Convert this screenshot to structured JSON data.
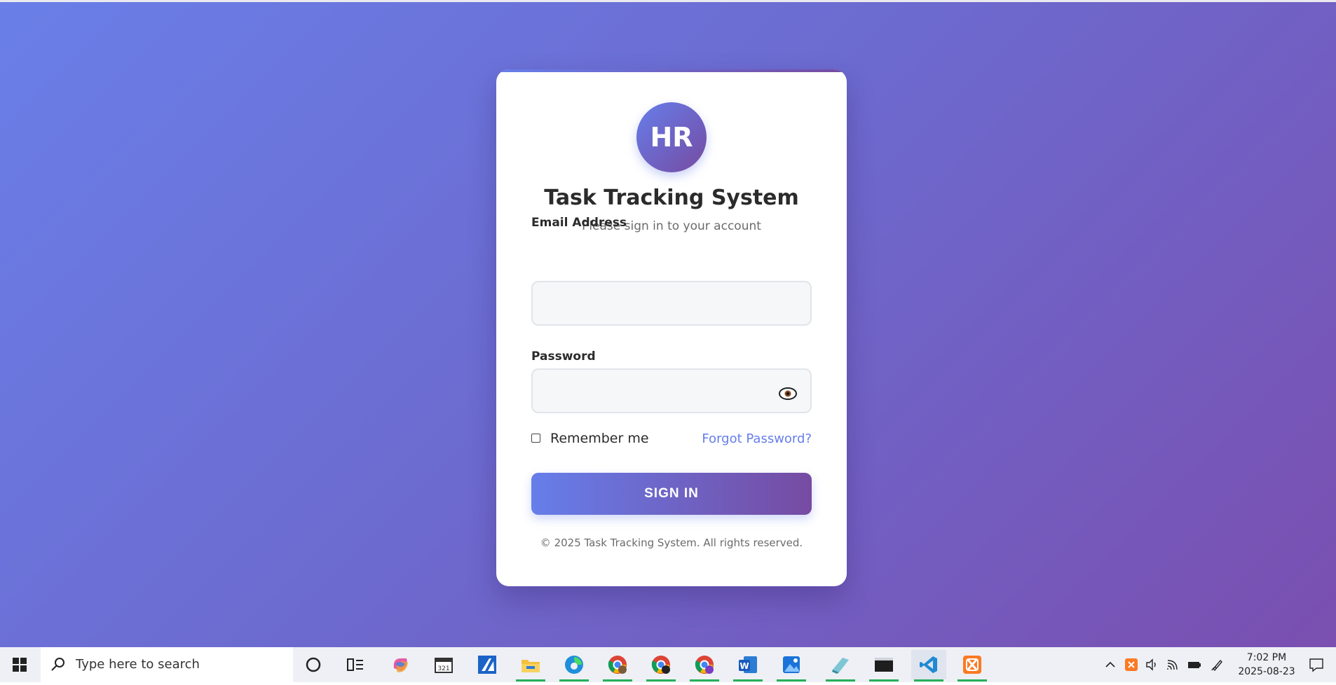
{
  "app": {
    "logo_text": "HR",
    "title": "Task Tracking System",
    "subtitle": "Please sign in to your account"
  },
  "form": {
    "email_label": "Email Address",
    "email_value": "",
    "password_label": "Password",
    "password_value": "",
    "remember_label": "Remember me",
    "remember_checked": false,
    "forgot_label": "Forgot Password?",
    "signin_label": "SIGN IN"
  },
  "footer": {
    "text": "© 2025 Task Tracking System. All rights reserved."
  },
  "colors": {
    "accent_start": "#667eea",
    "accent_end": "#764ba2"
  },
  "taskbar": {
    "search_placeholder": "Type here to search",
    "apps": [
      "start-icon",
      "cortana-icon",
      "task-view-icon",
      "copilot-icon",
      "media-player-icon",
      "app-a-icon",
      "file-explorer-icon",
      "edge-icon",
      "chrome-profile-1-icon",
      "chrome-profile-2-icon",
      "chrome-profile-3-icon",
      "word-icon",
      "photos-icon",
      "editor-icon",
      "terminal-icon",
      "vscode-icon",
      "xampp-icon"
    ],
    "clock": {
      "time": "7:02 PM",
      "date": "2025-08-23"
    }
  }
}
